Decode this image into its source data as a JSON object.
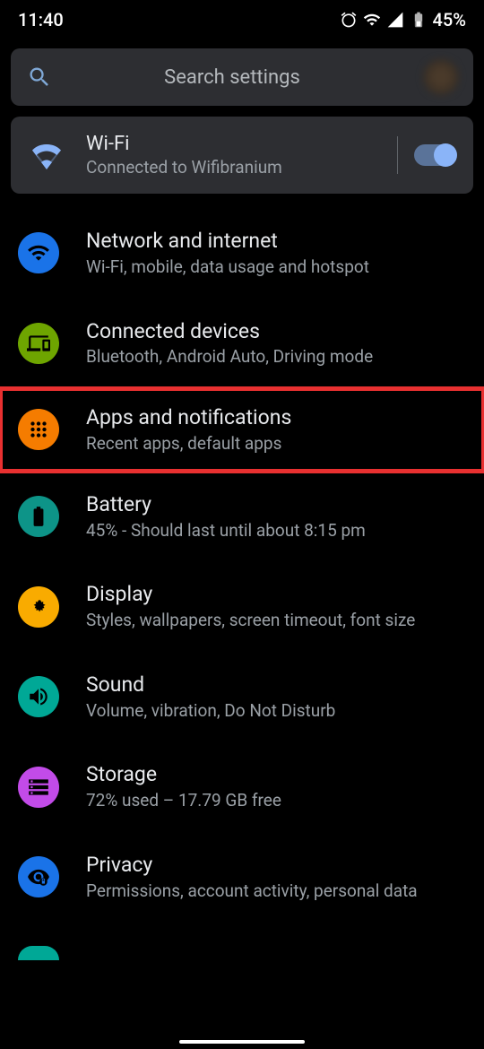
{
  "status": {
    "time": "11:40",
    "battery": "45%"
  },
  "search": {
    "placeholder": "Search settings"
  },
  "wifi": {
    "title": "Wi-Fi",
    "subtitle": "Connected to Wifibranium"
  },
  "items": [
    {
      "title": "Network and internet",
      "subtitle": "Wi-Fi, mobile, data usage and hotspot",
      "icon": "wifi",
      "bg": "bg-blue",
      "highlighted": false
    },
    {
      "title": "Connected devices",
      "subtitle": "Bluetooth, Android Auto, Driving mode",
      "icon": "devices",
      "bg": "bg-green",
      "highlighted": false
    },
    {
      "title": "Apps and notifications",
      "subtitle": "Recent apps, default apps",
      "icon": "apps",
      "bg": "bg-orange",
      "highlighted": true
    },
    {
      "title": "Battery",
      "subtitle": "45% - Should last until about 8:15 pm",
      "icon": "battery",
      "bg": "bg-teal-dark",
      "highlighted": false
    },
    {
      "title": "Display",
      "subtitle": "Styles, wallpapers, screen timeout, font size",
      "icon": "display",
      "bg": "bg-amber",
      "highlighted": false
    },
    {
      "title": "Sound",
      "subtitle": "Volume, vibration, Do Not Disturb",
      "icon": "sound",
      "bg": "bg-teal",
      "highlighted": false
    },
    {
      "title": "Storage",
      "subtitle": "72% used – 17.79 GB free",
      "icon": "storage",
      "bg": "bg-purple",
      "highlighted": false
    },
    {
      "title": "Privacy",
      "subtitle": "Permissions, account activity, personal data",
      "icon": "privacy",
      "bg": "bg-blue2",
      "highlighted": false
    }
  ]
}
